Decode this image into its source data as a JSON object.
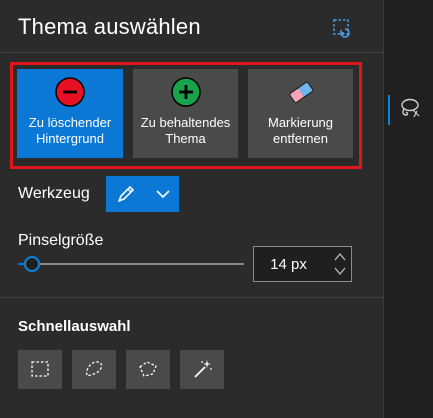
{
  "panel": {
    "title": "Thema auswählen"
  },
  "modes": [
    {
      "label_line1": "Zu löschender",
      "label_line2": "Hintergrund",
      "icon": "minus-circle-icon",
      "selected": true
    },
    {
      "label_line1": "Zu behaltendes",
      "label_line2": "Thema",
      "icon": "plus-circle-icon",
      "selected": false
    },
    {
      "label_line1": "Markierung",
      "label_line2": "entfernen",
      "icon": "eraser-icon",
      "selected": false
    }
  ],
  "tool": {
    "label": "Werkzeug",
    "selected_icon": "pen-icon"
  },
  "brush": {
    "label": "Pinselgröße",
    "value": "14 px",
    "slider_fraction": 0.06
  },
  "quick_select": {
    "label": "Schnellauswahl",
    "tools": [
      "rectangle-select-icon",
      "lasso-select-icon",
      "polygon-lasso-icon",
      "magic-wand-icon"
    ]
  },
  "colors": {
    "accent": "#0a78d4",
    "highlight_border": "#e0161c",
    "remove": "#e81123",
    "keep": "#16a34a"
  }
}
